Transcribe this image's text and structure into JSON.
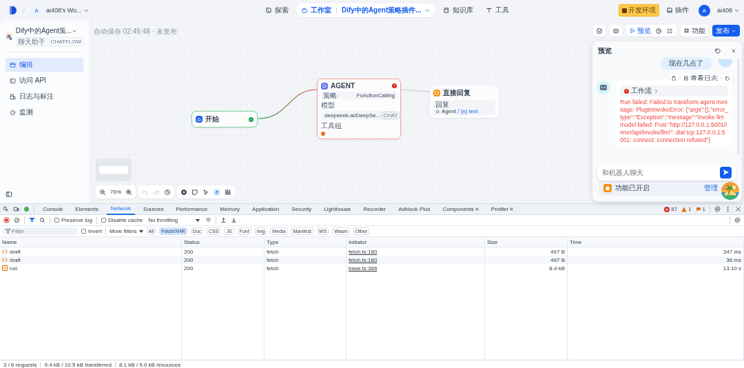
{
  "header": {
    "workspace_avatar": "A",
    "workspace": "ai408's Wo...",
    "nav": [
      {
        "kind": "plain",
        "label": "探索",
        "selected": false
      },
      {
        "kind": "studio",
        "label": "工作室",
        "app": "Dify中的Agent策略插件...",
        "selected": true
      },
      {
        "kind": "plain",
        "label": "知识库",
        "selected": false
      },
      {
        "kind": "plain",
        "label": "工具",
        "selected": false
      }
    ],
    "env_badge": "开发环境",
    "plugins": "插件",
    "user_avatar": "A",
    "user": "ai408"
  },
  "sidebar": {
    "app_name": "Dify中的Agent策...",
    "tags": [
      "聊天助手",
      "CHATFLOW"
    ],
    "items": [
      {
        "label": "编排",
        "selected": true
      },
      {
        "label": "访问 API",
        "selected": false
      },
      {
        "label": "日志与标注",
        "selected": false
      },
      {
        "label": "监测",
        "selected": false
      }
    ]
  },
  "canvas": {
    "autosave": "自动保存 02:45:48 · 未发布",
    "preview": "预览",
    "features": "功能",
    "publish": "发布",
    "start": {
      "title": "开始"
    },
    "agent": {
      "title": "AGENT",
      "strategy_label": "策略",
      "strategy": "FunctionCalling",
      "model_label": "模型",
      "model": "deepseek-ai/DeepSe...",
      "model_mode": "CHAT",
      "tools_label": "工具组"
    },
    "answer": {
      "title": "直接回复",
      "reply_label": "回复",
      "source": "Agent",
      "variable": "{x} text"
    },
    "zoom": "76%"
  },
  "preview": {
    "title": "预览",
    "user_message": "现在几点了",
    "log_button": "查看日志",
    "workflow": "工作流",
    "error": "Run failed: Failed to transform agent message: PluginInvokeError: {\"args\":{},\"error_type\":\"Exception\",\"message\":\"invoke llm model failed: Post \"http://127.0.0.1:5001/inner/api/invoke/llm\\\": dial tcp 127.0.0.1:5001: connect: connection refused\"}",
    "placeholder": "和机器人聊天",
    "features_on": "功能已开启",
    "manage": "管理"
  },
  "devtools": {
    "tabs": [
      {
        "label": "Console",
        "selected": false
      },
      {
        "label": "Elements",
        "selected": false
      },
      {
        "label": "Network",
        "selected": true
      },
      {
        "label": "Sources",
        "selected": false
      },
      {
        "label": "Performance",
        "selected": false
      },
      {
        "label": "Memory",
        "selected": false
      },
      {
        "label": "Application",
        "selected": false
      },
      {
        "label": "Security",
        "selected": false
      },
      {
        "label": "Lighthouse",
        "selected": false
      },
      {
        "label": "Recorder",
        "selected": false
      },
      {
        "label": "Adblock Plus",
        "selected": false
      },
      {
        "label": "Components",
        "selected": false
      },
      {
        "label": "Profiler",
        "selected": false
      }
    ],
    "errors": "57",
    "warnings": "1",
    "issues": "1",
    "preserve_log": {
      "label": "Preserve log",
      "checked": false
    },
    "disable_cache": {
      "label": "Disable cache",
      "checked": false
    },
    "throttling": "No throttling",
    "filter_placeholder": "Filter",
    "invert": {
      "label": "Invert",
      "checked": false
    },
    "more_filters": "More filters",
    "types": [
      {
        "label": "All",
        "selected": false
      },
      {
        "label": "Fetch/XHR",
        "selected": true
      },
      {
        "label": "Doc",
        "selected": false
      },
      {
        "label": "CSS",
        "selected": false
      },
      {
        "label": "JS",
        "selected": false
      },
      {
        "label": "Font",
        "selected": false
      },
      {
        "label": "Img",
        "selected": false
      },
      {
        "label": "Media",
        "selected": false
      },
      {
        "label": "Manifest",
        "selected": false
      },
      {
        "label": "WS",
        "selected": false
      },
      {
        "label": "Wasm",
        "selected": false
      },
      {
        "label": "Other",
        "selected": false
      }
    ],
    "columns": [
      "Name",
      "Status",
      "Type",
      "Initiator",
      "Size",
      "Time"
    ],
    "rows": [
      {
        "kind": "xhr",
        "name": "draft",
        "status": "200",
        "type": "fetch",
        "initiator": "fetch.ts:180",
        "size": "497 B",
        "time": "347 ms"
      },
      {
        "kind": "xhr",
        "name": "draft",
        "status": "200",
        "type": "fetch",
        "initiator": "fetch.ts:180",
        "size": "497 B",
        "time": "36 ms"
      },
      {
        "kind": "document",
        "name": "run",
        "status": "200",
        "type": "fetch",
        "initiator": "base.ts:366",
        "size": "8.4 kB",
        "time": "13.10 s"
      }
    ],
    "summary": [
      "3 / 6 requests",
      "9.4 kB / 10.5 kB transferred",
      "8.1 kB / 9.0 kB resources"
    ]
  }
}
